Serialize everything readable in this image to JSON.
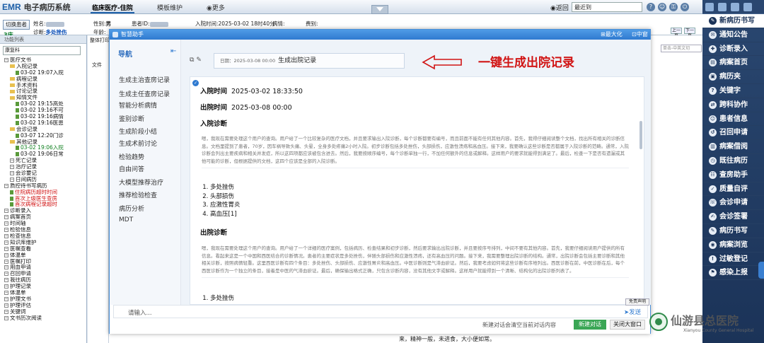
{
  "app": {
    "logo": "EMR",
    "system_name": "电子病历系统",
    "top_tabs": [
      "临床医疗-住院",
      "模板维护",
      "更多"
    ],
    "back_label": "返回",
    "recent_placeholder": "最近到"
  },
  "patient_bar": {
    "switch_button": "切换患者",
    "bed": "3床",
    "name_label": "姓名:",
    "gender_label": "性别:",
    "gender": "男",
    "id_label": "患者ID:",
    "admit_label": "入院时间:",
    "admit_time": "2025-03-02 18时40分",
    "status_label": "病情:",
    "allergy_label": "费别:",
    "diag_label": "诊断:",
    "diag_value": "多处挫伤",
    "age_label": "年龄:",
    "nav_prev": "上一页",
    "nav_next": "下一页"
  },
  "left_panel": {
    "header": "功能列表",
    "dept": "康复科",
    "tree": [
      {
        "text": "医疗文书",
        "level": 0,
        "type": "box"
      },
      {
        "text": "入院记录",
        "level": 1,
        "type": "fold"
      },
      {
        "text": "03-02 19:07入院",
        "level": 2,
        "type": "doc"
      },
      {
        "text": "病程记录",
        "level": 1,
        "type": "fold"
      },
      {
        "text": "手术资料",
        "level": 1,
        "type": "fold"
      },
      {
        "text": "讨论记录",
        "level": 1,
        "type": "fold"
      },
      {
        "text": "知情文件",
        "level": 1,
        "type": "fold"
      },
      {
        "text": "03-02 19:15高处",
        "level": 2,
        "type": "doc"
      },
      {
        "text": "03-02 19:16不可",
        "level": 2,
        "type": "doc"
      },
      {
        "text": "03-02 19:16病情",
        "level": 2,
        "type": "doc"
      },
      {
        "text": "03-02 19:16医患",
        "level": 2,
        "type": "doc"
      },
      {
        "text": "会诊记录",
        "level": 1,
        "type": "fold"
      },
      {
        "text": "03-07 12:20门诊",
        "level": 2,
        "type": "doc"
      },
      {
        "text": "其他记录",
        "level": 1,
        "type": "fold"
      },
      {
        "text": "03-02 19:06入院",
        "level": 2,
        "type": "doc",
        "color": "green"
      },
      {
        "text": "03-02 19:06日常",
        "level": 2,
        "type": "doc"
      },
      {
        "text": "死亡记录",
        "level": 1,
        "type": "box"
      },
      {
        "text": "治疗记录",
        "level": 1,
        "type": "box"
      },
      {
        "text": "会诊要记",
        "level": 1,
        "type": "box"
      },
      {
        "text": "日间病历",
        "level": 1,
        "type": "box"
      },
      {
        "text": "质控待书写病历",
        "level": 0,
        "type": "box"
      },
      {
        "text": "住院病历超时时间",
        "level": 1,
        "type": "doc",
        "color": "red"
      },
      {
        "text": "首次上级医生查房",
        "level": 1,
        "type": "doc",
        "color": "red"
      },
      {
        "text": "首次病程记录超时",
        "level": 1,
        "type": "doc",
        "color": "red"
      },
      {
        "text": "诊断录入",
        "level": 0,
        "type": "box"
      },
      {
        "text": "病案首页",
        "level": 0,
        "type": "box"
      },
      {
        "text": "时间轴",
        "level": 0,
        "type": "box"
      },
      {
        "text": "检验信息",
        "level": 0,
        "type": "box"
      },
      {
        "text": "检查信息",
        "level": 0,
        "type": "box"
      },
      {
        "text": "知识库维护",
        "level": 0,
        "type": "box"
      },
      {
        "text": "医嘱查看",
        "level": 0,
        "type": "box"
      },
      {
        "text": "体温单",
        "level": 0,
        "type": "box"
      },
      {
        "text": "医嘱打印",
        "level": 0,
        "type": "box"
      },
      {
        "text": "用血申请",
        "level": 0,
        "type": "box"
      },
      {
        "text": "召回申请",
        "level": 0,
        "type": "box"
      },
      {
        "text": "我往病历",
        "level": 0,
        "type": "box"
      },
      {
        "text": "护理记录",
        "level": 0,
        "type": "box"
      },
      {
        "text": "体温单",
        "level": 0,
        "type": "box"
      },
      {
        "text": "护理文书",
        "level": 0,
        "type": "box"
      },
      {
        "text": "护理评估",
        "level": 0,
        "type": "box"
      },
      {
        "text": "关键词",
        "level": 0,
        "type": "box"
      },
      {
        "text": "文书历次阅读",
        "level": 0,
        "type": "box"
      }
    ]
  },
  "mid_strip": {
    "label1": "整体打印",
    "label2": "文件"
  },
  "doc_area": {
    "search_placeholder": "单击-中英文切",
    "tail_text": "来，精神一般，未进食，大小便如常。"
  },
  "dialog": {
    "title": "智慧助手",
    "maximize": "最大化",
    "medium": "中窗",
    "nav_title": "导航",
    "nav_items": [
      "生成主治查房记录",
      "生成主任查房记录",
      "智能分析病情",
      "鉴别诊断",
      "生成阶段小结",
      "生成术前讨论",
      "检验趋势",
      "自由问答",
      "大模型推荐治疗",
      "推荐检验检查",
      "病历分析",
      "MDT"
    ],
    "time_label": "日期：2025-03-08 00:00",
    "time_highlight": "08 00:00",
    "output_title": "生成出院记录",
    "annotation": "一键生成出院记录",
    "admit_h": "入院时间",
    "admit_v": "2025-03-02 18:33:50",
    "discharge_h": "出院时间",
    "discharge_v": "2025-03-08 00:00",
    "admit_diag_h": "入院诊断",
    "admit_diag_para": "嗯，我现在需要处理这个用户的查询。用户给了一个比较复杂的医疗文档，并且要求输出入院诊断，每个诊断都要有编号，而且前面不能有任何其他内容。首先，我得仔细阅读整个文档，找出所有相关的诊断信息。文档里提到了患者，70岁，因车祸导致头痛、头晕，全身多处疼痛2小时入院。初步诊断包括多处挫伤，头部损伤，应激性溃疡和高血压。接下来，我要确认这些诊断是否都属于入院诊断的范畴。通常，入院诊断会列出主要疾病和相关并发症，所以这四项都应该被包含进去。然后，我要按顺序编号，每个诊断单独一行，不加任何额外的信息或解释。这样用户的要求就能得到满足了。最后，检查一下是否有遗漏或其他可能的诊断，但根据提供的文档，这四个应该是全部的入院诊断。",
    "admit_diag_list": [
      "多处挫伤",
      "头部损伤",
      "应激性胃炎",
      "高血压[1]"
    ],
    "discharge_diag_h": "出院诊断",
    "discharge_diag_para": "嗯，我现在需要处理这个用户的查询。用户给了一个详细的医疗案例，包括病历、检查结果和初步诊断，然后要求输出出院诊断，并且要按序号排列，中间不要有其他内容。首先，我要仔细阅读用户提供的所有信息。看起来这是一个中国和西医结合的诊断情况。患者的主要症状是多处挫伤，伴随头部损伤和应激性溃疡，还有高血压的问题。接下来，我需要整理出院诊断的结构。通常，出院诊断会包括主要诊断和其他相关诊断，按照病情轻重。这里西医诊断有四个条目：多处挫伤、头部损伤、应激性胃炎和高血压。中医诊断则是气滞血瘀证。然后，我要考虑如何将这些诊断有序地列出。西医诊断在前，中医诊断在后，每个西医诊断作为一个独立的条目，接着是中医的气滞血瘀证。最后，确保输出格式正确，只包含诊断内容，没有其他文字或解释。这样用户就能得到一个清晰、结构化的出院诊断列表了。",
    "discharge_diag_first": "多处挫伤",
    "input_placeholder": "请输入...",
    "disclaimer": "免责声明",
    "send": "发送",
    "clear_hint": "新建对话会清空当前对话内容",
    "new_chat": "新建对话",
    "close_big": "关闭大窗口"
  },
  "right_sidebar": {
    "items": [
      {
        "label": "新病历书写",
        "icon": "✎",
        "active": true
      },
      {
        "label": "通知公告",
        "icon": "✉"
      },
      {
        "label": "诊断录入",
        "icon": "✚"
      },
      {
        "label": "病案首页",
        "icon": "▤"
      },
      {
        "label": "病历夹",
        "icon": "▣"
      },
      {
        "label": "关键字",
        "icon": "?"
      },
      {
        "label": "跨科协作",
        "icon": "⇄"
      },
      {
        "label": "患者信息",
        "icon": "☺"
      },
      {
        "label": "召回申请",
        "icon": "↺"
      },
      {
        "label": "病案借阅",
        "icon": "▥"
      },
      {
        "label": "既往病历",
        "icon": "◷"
      },
      {
        "label": "查房助手",
        "icon": "☷"
      },
      {
        "label": "质量自评",
        "icon": "✓"
      },
      {
        "label": "会诊申请",
        "icon": "☏"
      },
      {
        "label": "会诊签署",
        "icon": "✍"
      },
      {
        "label": "病历书写",
        "icon": "✎"
      },
      {
        "label": "病案浏览",
        "icon": "◉"
      },
      {
        "label": "过敏登记",
        "icon": "!"
      },
      {
        "label": "感染上报",
        "icon": "⚑"
      }
    ]
  },
  "watermark": {
    "cn": "仙游县总医院",
    "en": "Xianyou County General Hospital"
  }
}
